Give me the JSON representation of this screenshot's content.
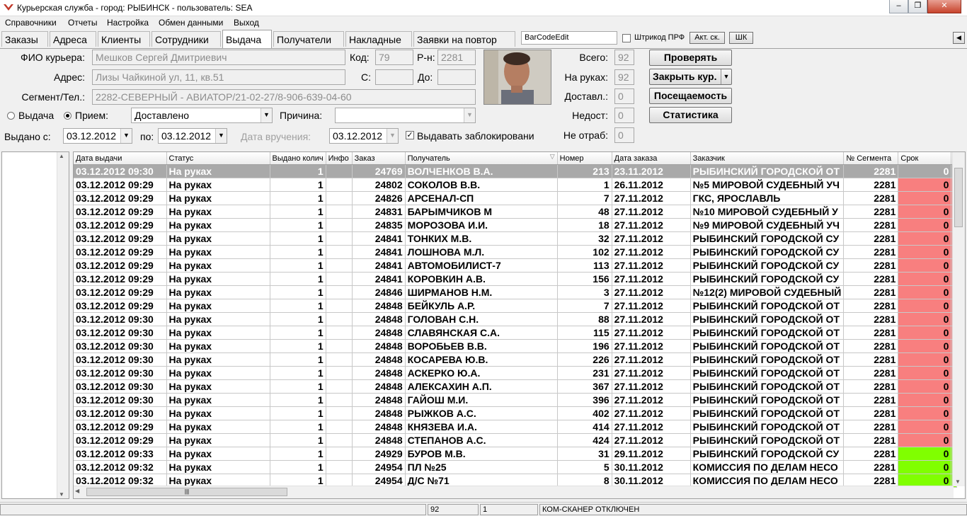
{
  "window": {
    "title": "Курьерская служба  - город: РЫБИНСК  - пользователь: SEA"
  },
  "menu": [
    "Справочники",
    "Отчеты",
    "Настройка",
    "Обмен данными",
    "Выход"
  ],
  "tabs": [
    "Заказы",
    "Адреса",
    "Клиенты",
    "Сотрудники",
    "Выдача",
    "Получатели",
    "Накладные",
    "Заявки на повтор"
  ],
  "active_tab": "Выдача",
  "toolbar": {
    "barcode_value": "BarCodeEdit",
    "pfr_label": "Штрикод ПРФ",
    "akt_button": "Акт. ск.",
    "shk_button": "ШК"
  },
  "courier": {
    "fio_label": "ФИО курьера:",
    "fio_value": "Мешков Сергей Дмитриевич",
    "code_label": "Код:",
    "code_value": "79",
    "district_label": "Р-н:",
    "district_value": "2281",
    "address_label": "Адрес:",
    "address_value": "Лизы Чайкиной ул, 11, кв.51",
    "from_label": "С:",
    "to_label": "До:",
    "segment_label": "Сегмент/Тел.:",
    "segment_value": "2282-СЕВЕРНЫЙ - АВИАТОР/21-02-27/8-906-639-04-60"
  },
  "mode": {
    "issue_label": "Выдача",
    "receive_label": "Прием:",
    "status_value": "Доставлено",
    "reason_label": "Причина:",
    "reason_value": ""
  },
  "dates": {
    "issued_from_label": "Выдано с:",
    "issued_from": "03.12.2012",
    "to_label": "по:",
    "issued_to": "03.12.2012",
    "delivery_label": "Дата вручения:",
    "delivery_date": "03.12.2012",
    "blocked_label": "Выдавать заблокировани"
  },
  "stats": [
    {
      "label": "Всего:",
      "value": "92"
    },
    {
      "label": "На руках:",
      "value": "92"
    },
    {
      "label": "Доставл.:",
      "value": "0"
    },
    {
      "label": "Недост:",
      "value": "0"
    },
    {
      "label": "Не отраб:",
      "value": "0"
    }
  ],
  "buttons": {
    "check": "Проверять",
    "close_courier": "Закрыть кур.",
    "attendance": "Посещаемость",
    "statistics": "Статистика"
  },
  "grid": {
    "columns": [
      "Дата выдачи",
      "Статус",
      "Выдано колич",
      "Инфо",
      "Заказ",
      "Получатель",
      "Номер",
      "Дата заказа",
      "Заказчик",
      "№ Сегмента",
      "Срок"
    ],
    "rows": [
      [
        "03.12.2012 09:30",
        "На руках",
        "1",
        "",
        "24769",
        "ВОЛЧЕНКОВ В.А.",
        "213",
        "23.11.2012",
        "РЫБИНСКИЙ ГОРОДСКОЙ ОТ",
        "2281",
        "0"
      ],
      [
        "03.12.2012 09:29",
        "На руках",
        "1",
        "",
        "24802",
        "СОКОЛОВ В.В.",
        "1",
        "26.11.2012",
        "№5 МИРОВОЙ СУДЕБНЫЙ УЧ",
        "2281",
        "0"
      ],
      [
        "03.12.2012 09:29",
        "На руках",
        "1",
        "",
        "24826",
        "АРСЕНАЛ-СП",
        "7",
        "27.11.2012",
        "ГКС, ЯРОСЛАВЛЬ",
        "2281",
        "0"
      ],
      [
        "03.12.2012 09:29",
        "На руках",
        "1",
        "",
        "24831",
        "БАРЫМЧИКОВ М",
        "48",
        "27.11.2012",
        "№10 МИРОВОЙ СУДЕБНЫЙ У",
        "2281",
        "0"
      ],
      [
        "03.12.2012 09:29",
        "На руках",
        "1",
        "",
        "24835",
        "МОРОЗОВА И.И.",
        "18",
        "27.11.2012",
        "№9 МИРОВОЙ СУДЕБНЫЙ УЧ",
        "2281",
        "0"
      ],
      [
        "03.12.2012 09:29",
        "На руках",
        "1",
        "",
        "24841",
        "ТОНКИХ М.В.",
        "32",
        "27.11.2012",
        "РЫБИНСКИЙ ГОРОДСКОЙ СУ",
        "2281",
        "0"
      ],
      [
        "03.12.2012 09:29",
        "На руках",
        "1",
        "",
        "24841",
        "ЛОШНОВА М.Л.",
        "102",
        "27.11.2012",
        "РЫБИНСКИЙ ГОРОДСКОЙ СУ",
        "2281",
        "0"
      ],
      [
        "03.12.2012 09:29",
        "На руках",
        "1",
        "",
        "24841",
        "АВТОМОБИЛИСТ-7",
        "113",
        "27.11.2012",
        "РЫБИНСКИЙ ГОРОДСКОЙ СУ",
        "2281",
        "0"
      ],
      [
        "03.12.2012 09:29",
        "На руках",
        "1",
        "",
        "24841",
        "КОРОВКИН А.В.",
        "156",
        "27.11.2012",
        "РЫБИНСКИЙ ГОРОДСКОЙ СУ",
        "2281",
        "0"
      ],
      [
        "03.12.2012 09:29",
        "На руках",
        "1",
        "",
        "24846",
        "ШИРМАНОВ Н.М.",
        "3",
        "27.11.2012",
        "№12(2) МИРОВОЙ СУДЕБНЫЙ",
        "2281",
        "0"
      ],
      [
        "03.12.2012 09:29",
        "На руках",
        "1",
        "",
        "24848",
        "БЕЙКУЛЬ А.Р.",
        "7",
        "27.11.2012",
        "РЫБИНСКИЙ ГОРОДСКОЙ ОТ",
        "2281",
        "0"
      ],
      [
        "03.12.2012 09:30",
        "На руках",
        "1",
        "",
        "24848",
        "ГОЛОВАН С.Н.",
        "88",
        "27.11.2012",
        "РЫБИНСКИЙ ГОРОДСКОЙ ОТ",
        "2281",
        "0"
      ],
      [
        "03.12.2012 09:30",
        "На руках",
        "1",
        "",
        "24848",
        "СЛАВЯНСКАЯ С.А.",
        "115",
        "27.11.2012",
        "РЫБИНСКИЙ ГОРОДСКОЙ ОТ",
        "2281",
        "0"
      ],
      [
        "03.12.2012 09:30",
        "На руках",
        "1",
        "",
        "24848",
        "ВОРОБЬЕВ В.В.",
        "196",
        "27.11.2012",
        "РЫБИНСКИЙ ГОРОДСКОЙ ОТ",
        "2281",
        "0"
      ],
      [
        "03.12.2012 09:30",
        "На руках",
        "1",
        "",
        "24848",
        "КОСАРЕВА Ю.В.",
        "226",
        "27.11.2012",
        "РЫБИНСКИЙ ГОРОДСКОЙ ОТ",
        "2281",
        "0"
      ],
      [
        "03.12.2012 09:30",
        "На руках",
        "1",
        "",
        "24848",
        "АСКЕРКО Ю.А.",
        "231",
        "27.11.2012",
        "РЫБИНСКИЙ ГОРОДСКОЙ ОТ",
        "2281",
        "0"
      ],
      [
        "03.12.2012 09:30",
        "На руках",
        "1",
        "",
        "24848",
        "АЛЕКСАХИН А.П.",
        "367",
        "27.11.2012",
        "РЫБИНСКИЙ ГОРОДСКОЙ ОТ",
        "2281",
        "0"
      ],
      [
        "03.12.2012 09:30",
        "На руках",
        "1",
        "",
        "24848",
        "ГАЙОШ М.И.",
        "396",
        "27.11.2012",
        "РЫБИНСКИЙ ГОРОДСКОЙ ОТ",
        "2281",
        "0"
      ],
      [
        "03.12.2012 09:30",
        "На руках",
        "1",
        "",
        "24848",
        "РЫЖКОВ А.С.",
        "402",
        "27.11.2012",
        "РЫБИНСКИЙ ГОРОДСКОЙ ОТ",
        "2281",
        "0"
      ],
      [
        "03.12.2012 09:29",
        "На руках",
        "1",
        "",
        "24848",
        "КНЯЗЕВА И.А.",
        "414",
        "27.11.2012",
        "РЫБИНСКИЙ ГОРОДСКОЙ ОТ",
        "2281",
        "0"
      ],
      [
        "03.12.2012 09:29",
        "На руках",
        "1",
        "",
        "24848",
        "СТЕПАНОВ А.С.",
        "424",
        "27.11.2012",
        "РЫБИНСКИЙ ГОРОДСКОЙ ОТ",
        "2281",
        "0"
      ],
      [
        "03.12.2012 09:33",
        "На руках",
        "1",
        "",
        "24929",
        "БУРОВ М.В.",
        "31",
        "29.11.2012",
        "РЫБИНСКИЙ ГОРОДСКОЙ СУ",
        "2281",
        "0"
      ],
      [
        "03.12.2012 09:32",
        "На руках",
        "1",
        "",
        "24954",
        "ПЛ №25",
        "5",
        "30.11.2012",
        "КОМИССИЯ ПО ДЕЛАМ НЕСО",
        "2281",
        "0"
      ],
      [
        "03.12.2012 09:32",
        "На руках",
        "1",
        "",
        "24954",
        "Д/С №71",
        "8",
        "30.11.2012",
        "КОМИССИЯ ПО ДЕЛАМ НЕСО",
        "2281",
        "0"
      ]
    ],
    "row_colors": [
      "none",
      "red",
      "red",
      "red",
      "red",
      "red",
      "red",
      "red",
      "red",
      "red",
      "red",
      "red",
      "red",
      "red",
      "red",
      "red",
      "red",
      "red",
      "red",
      "red",
      "red",
      "green",
      "green",
      "green"
    ]
  },
  "status": {
    "count": "92",
    "page": "1",
    "message": "КОМ-СКАНЕР ОТКЛЮЧЕН"
  },
  "colors": {
    "overdue": "#f87f7f",
    "ok": "#80ff00",
    "selected": "#a9a9a9"
  }
}
